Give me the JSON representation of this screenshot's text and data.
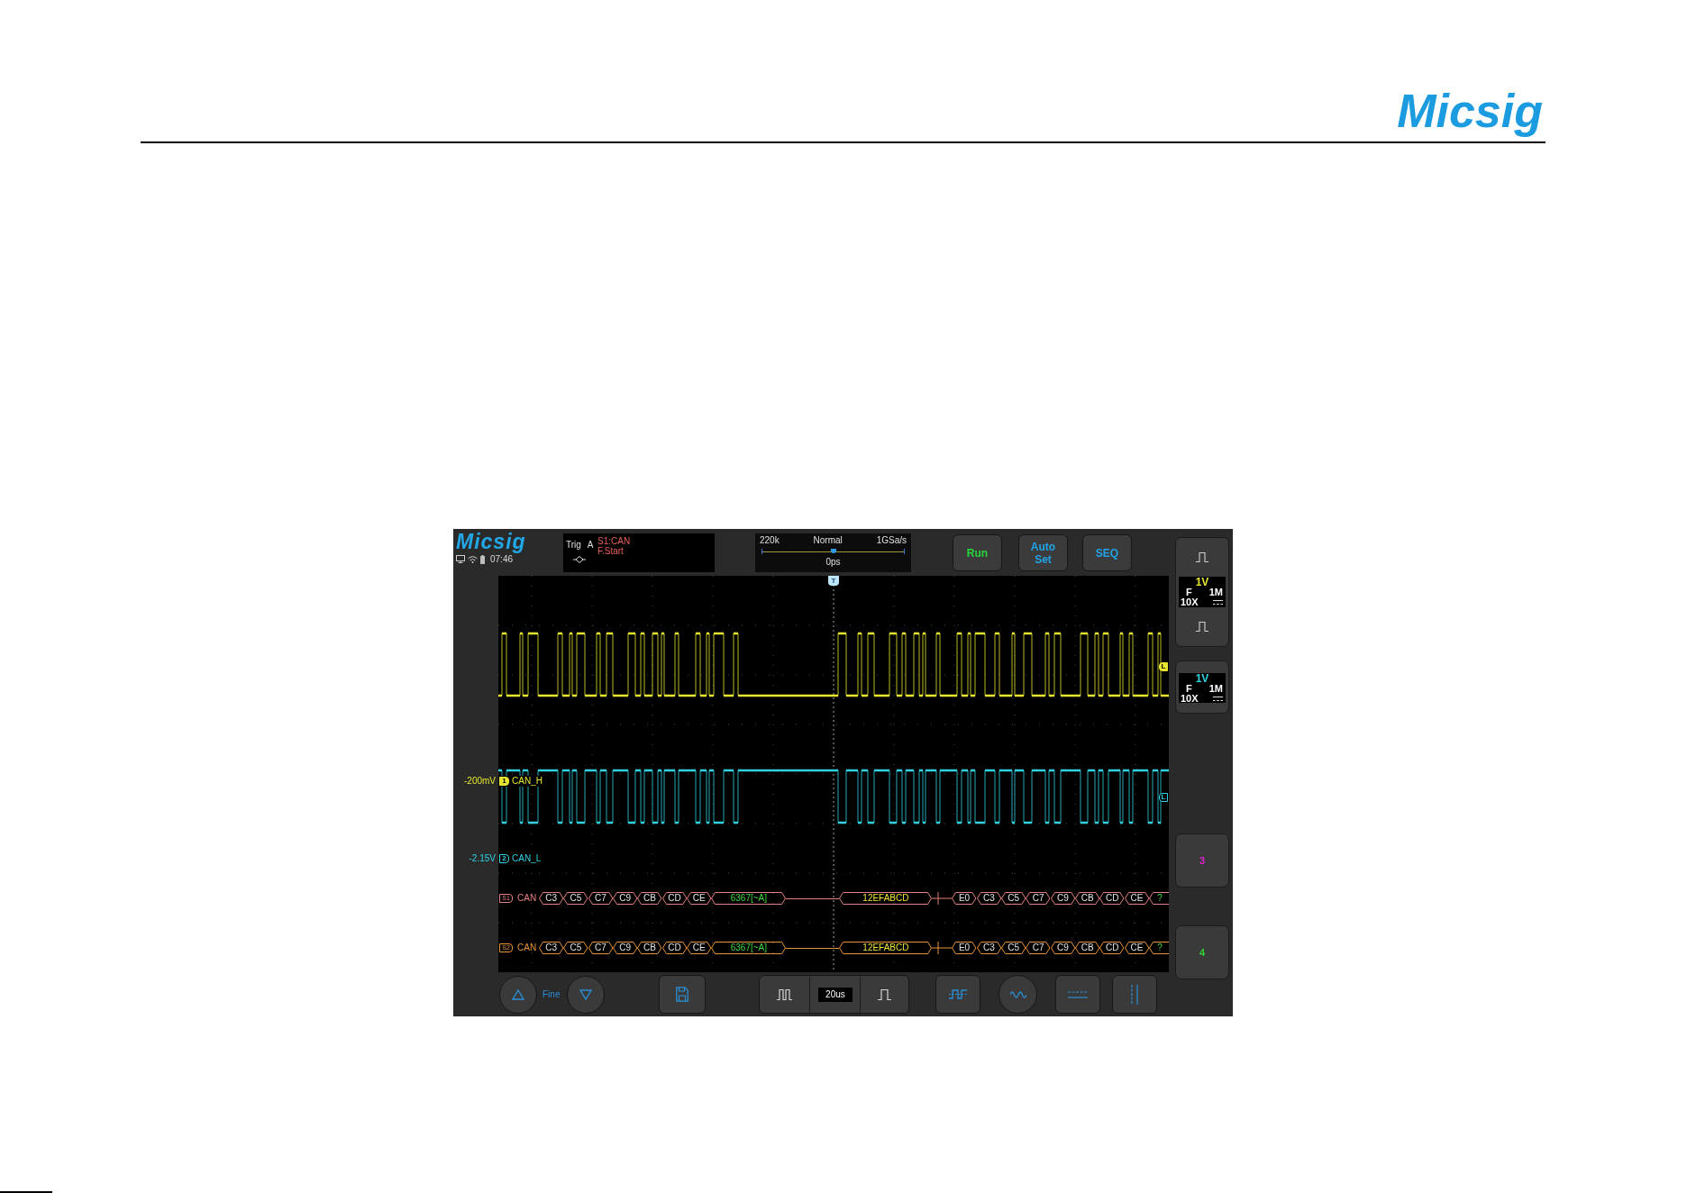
{
  "header": {
    "logo": "Micsig"
  },
  "scope": {
    "logo": "Micsig",
    "status": {
      "time": "07:46"
    },
    "trigger": {
      "label": "Trig",
      "source": "A",
      "type": "S1:CAN",
      "condition": "F.Start"
    },
    "acquisition": {
      "memory_depth": "220k",
      "mode": "Normal",
      "sample_rate": "1GSa/s",
      "position": {
        "level": 0.5,
        "reading": "0ps"
      }
    },
    "buttons": [
      {
        "label": "Run",
        "color": "#27d33b"
      },
      {
        "label": "Auto Set",
        "color": "#21a3e6"
      },
      {
        "label": "SEQ",
        "color": "#21a3e6"
      }
    ],
    "trigger_marker": "T",
    "traces": [
      {
        "offset": "-200mV",
        "marker": "1",
        "name": "CAN_H",
        "color": "#e6e62e",
        "selected": true,
        "level_marker": "L"
      },
      {
        "offset": "-2.15V",
        "marker": "2",
        "name": "CAN_L",
        "color": "#2fd3e3",
        "selected": false,
        "level_marker": "L"
      }
    ],
    "buses": [
      {
        "marker": "S1",
        "name": "CAN",
        "color": "#e58080",
        "frames": [
          {
            "kind": "byte",
            "text": "C3"
          },
          {
            "kind": "byte",
            "text": "C5"
          },
          {
            "kind": "byte",
            "text": "C7"
          },
          {
            "kind": "byte",
            "text": "C9"
          },
          {
            "kind": "byte",
            "text": "CB"
          },
          {
            "kind": "byte",
            "text": "CD"
          },
          {
            "kind": "byte",
            "text": "CE"
          },
          {
            "kind": "crc",
            "text": "6367[~A]"
          },
          {
            "kind": "idle"
          },
          {
            "kind": "id",
            "text": "12EFABCD"
          },
          {
            "kind": "tick"
          },
          {
            "kind": "byte",
            "text": "E0"
          },
          {
            "kind": "byte",
            "text": "C3"
          },
          {
            "kind": "byte",
            "text": "C5"
          },
          {
            "kind": "byte",
            "text": "C7"
          },
          {
            "kind": "byte",
            "text": "C9"
          },
          {
            "kind": "byte",
            "text": "CB"
          },
          {
            "kind": "byte",
            "text": "CD"
          },
          {
            "kind": "byte",
            "text": "CE"
          },
          {
            "kind": "partial",
            "text": "?"
          }
        ]
      },
      {
        "marker": "S2",
        "name": "CAN",
        "color": "#e8953a",
        "frames": [
          {
            "kind": "byte",
            "text": "C3"
          },
          {
            "kind": "byte",
            "text": "C5"
          },
          {
            "kind": "byte",
            "text": "C7"
          },
          {
            "kind": "byte",
            "text": "C9"
          },
          {
            "kind": "byte",
            "text": "CB"
          },
          {
            "kind": "byte",
            "text": "CD"
          },
          {
            "kind": "byte",
            "text": "CE"
          },
          {
            "kind": "crc",
            "text": "6367[~A]"
          },
          {
            "kind": "idle"
          },
          {
            "kind": "id",
            "text": "12EFABCD"
          },
          {
            "kind": "tick"
          },
          {
            "kind": "byte",
            "text": "E0"
          },
          {
            "kind": "byte",
            "text": "C3"
          },
          {
            "kind": "byte",
            "text": "C5"
          },
          {
            "kind": "byte",
            "text": "C7"
          },
          {
            "kind": "byte",
            "text": "C9"
          },
          {
            "kind": "byte",
            "text": "CB"
          },
          {
            "kind": "byte",
            "text": "CD"
          },
          {
            "kind": "byte",
            "text": "CE"
          },
          {
            "kind": "partial",
            "text": "?"
          }
        ]
      }
    ],
    "channels": [
      {
        "kind": "card",
        "selected": true,
        "scale": "1V",
        "bandwidth": "F",
        "impedance": "1M",
        "probe": "10X",
        "color": "#e6e62e"
      },
      {
        "kind": "card",
        "selected": false,
        "scale": "1V",
        "bandwidth": "F",
        "impedance": "1M",
        "probe": "10X",
        "color": "#2fd3e3"
      },
      {
        "kind": "button",
        "label": "3",
        "color": "#e020d8"
      },
      {
        "kind": "button",
        "label": "4",
        "color": "#2fd03a"
      }
    ],
    "bottom_bar": {
      "fine_label": "Fine",
      "timebase": "20us"
    }
  }
}
